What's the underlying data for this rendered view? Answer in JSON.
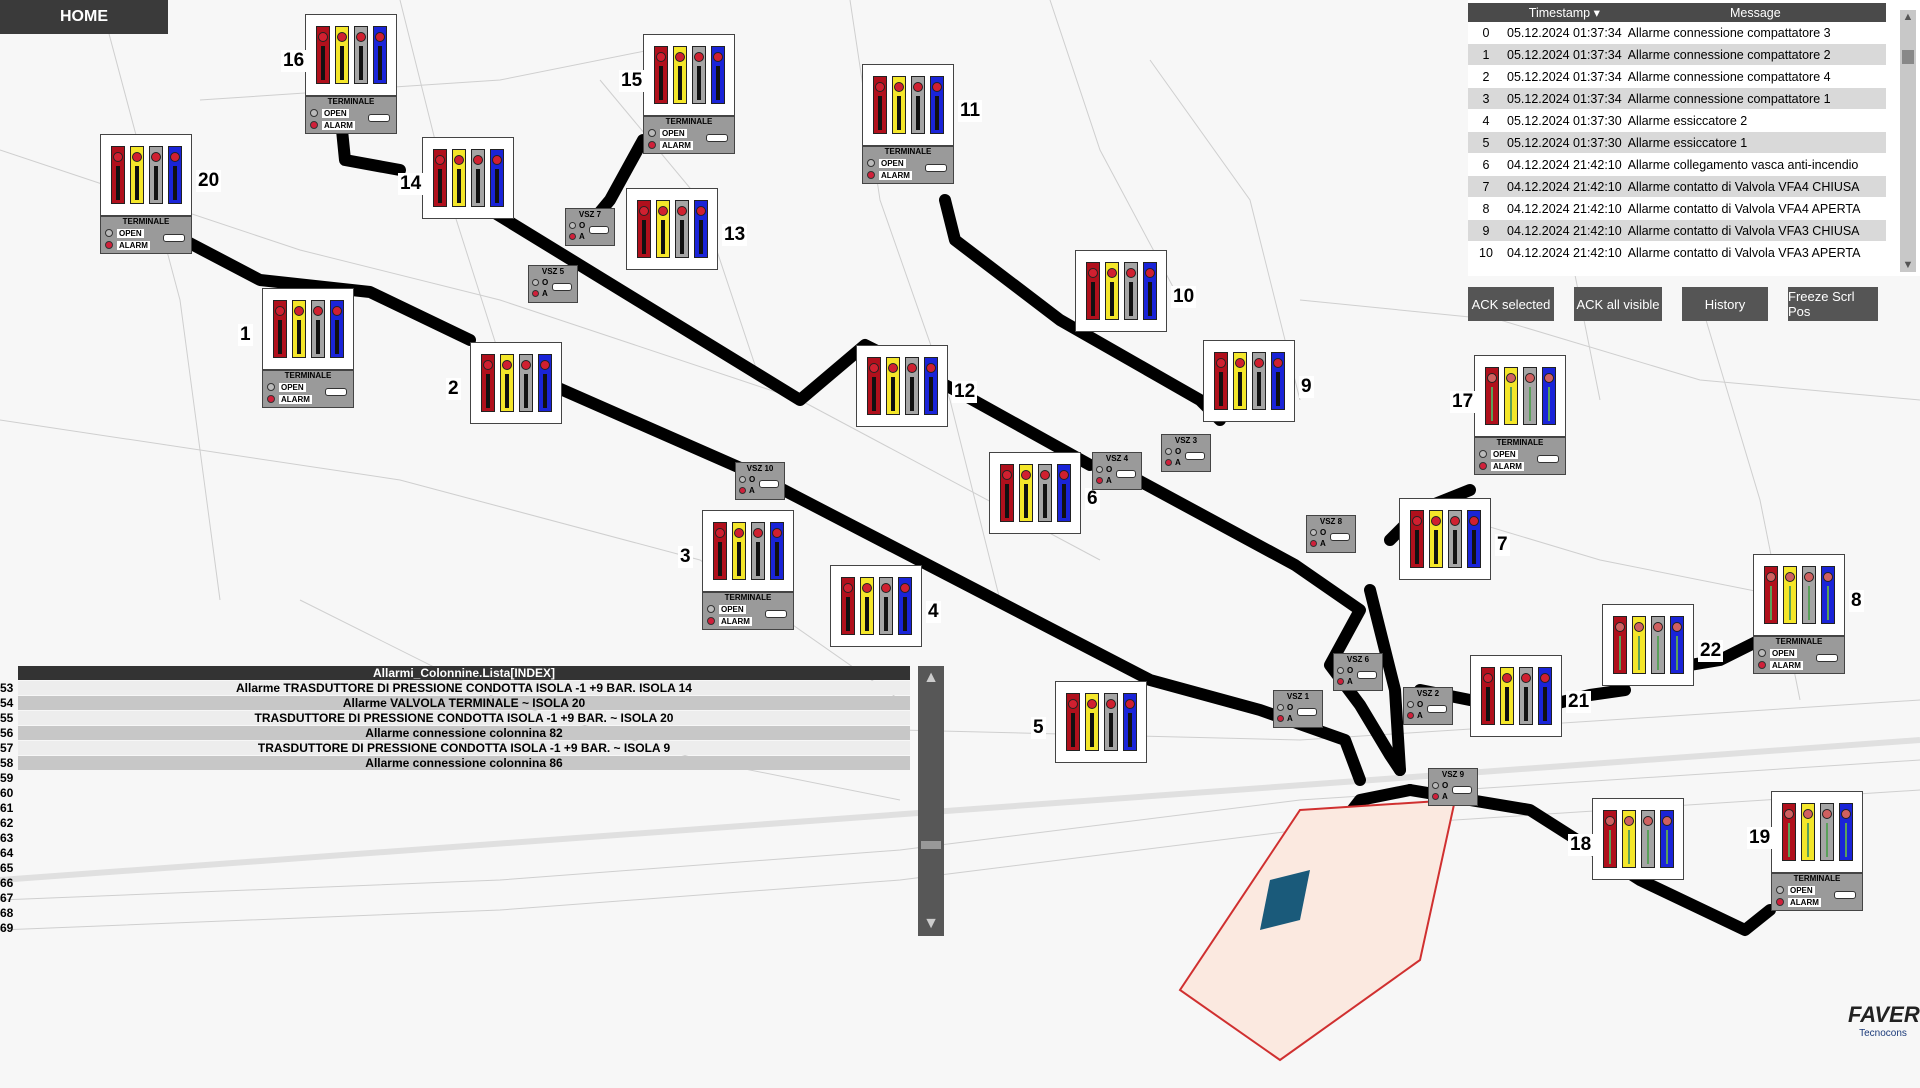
{
  "home_label": "HOME",
  "alarm_table": {
    "columns": [
      "",
      "Timestamp",
      "Message"
    ],
    "rows": [
      {
        "idx": "0",
        "ts": "05.12.2024 01:37:34",
        "msg": "Allarme connessione compattatore 3"
      },
      {
        "idx": "1",
        "ts": "05.12.2024 01:37:34",
        "msg": "Allarme connessione compattatore 2"
      },
      {
        "idx": "2",
        "ts": "05.12.2024 01:37:34",
        "msg": "Allarme connessione compattatore 4"
      },
      {
        "idx": "3",
        "ts": "05.12.2024 01:37:34",
        "msg": "Allarme connessione compattatore 1"
      },
      {
        "idx": "4",
        "ts": "05.12.2024 01:37:30",
        "msg": "Allarme essiccatore 2"
      },
      {
        "idx": "5",
        "ts": "05.12.2024 01:37:30",
        "msg": "Allarme essiccatore 1"
      },
      {
        "idx": "6",
        "ts": "04.12.2024 21:42:10",
        "msg": "Allarme collegamento vasca anti-incendio"
      },
      {
        "idx": "7",
        "ts": "04.12.2024 21:42:10",
        "msg": "Allarme contatto di Valvola VFA4 CHIUSA"
      },
      {
        "idx": "8",
        "ts": "04.12.2024 21:42:10",
        "msg": "Allarme contatto di Valvola VFA4 APERTA"
      },
      {
        "idx": "9",
        "ts": "04.12.2024 21:42:10",
        "msg": "Allarme contatto di Valvola VFA3 CHIUSA"
      },
      {
        "idx": "10",
        "ts": "04.12.2024 21:42:10",
        "msg": "Allarme contatto di Valvola VFA3 APERTA"
      }
    ]
  },
  "buttons": {
    "ack_selected": "ACK selected",
    "ack_all": "ACK all visible",
    "history": "History",
    "freeze": "Freeze Scrl Pos"
  },
  "list": {
    "header": "Allarmi_Colonnine.Lista[INDEX]",
    "rows": [
      {
        "n": "53",
        "t": "Allarme TRASDUTTORE DI PRESSIONE  CONDOTTA  ISOLA -1 +9 BAR. ISOLA 14"
      },
      {
        "n": "54",
        "t": "Allarme VALVOLA TERMINALE ~ ISOLA 20"
      },
      {
        "n": "55",
        "t": "TRASDUTTORE DI PRESSIONE  CONDOTTA  ISOLA -1 +9 BAR. ~ ISOLA 20"
      },
      {
        "n": "56",
        "t": "Allarme connessione colonnina 82"
      },
      {
        "n": "57",
        "t": "TRASDUTTORE DI PRESSIONE  CONDOTTA  ISOLA -1 +9 BAR. ~ ISOLA 9"
      },
      {
        "n": "58",
        "t": "Allarme connessione colonnina 86"
      },
      {
        "n": "59",
        "t": ""
      },
      {
        "n": "60",
        "t": ""
      },
      {
        "n": "61",
        "t": ""
      },
      {
        "n": "62",
        "t": ""
      },
      {
        "n": "63",
        "t": ""
      },
      {
        "n": "64",
        "t": ""
      },
      {
        "n": "65",
        "t": ""
      },
      {
        "n": "66",
        "t": ""
      },
      {
        "n": "67",
        "t": ""
      },
      {
        "n": "68",
        "t": ""
      },
      {
        "n": "69",
        "t": ""
      }
    ]
  },
  "terminal": {
    "title": "TERMINALE",
    "open": "OPEN",
    "alarm": "ALARM"
  },
  "islands": [
    "16",
    "15",
    "11",
    "14",
    "20",
    "13",
    "10",
    "1",
    "2",
    "9",
    "12",
    "17",
    "6",
    "3",
    "7",
    "4",
    "8",
    "22",
    "21",
    "5",
    "18",
    "19"
  ],
  "valves": [
    "VSZ 7",
    "VSZ 5",
    "VSZ 10",
    "VSZ 4",
    "VSZ 3",
    "VSZ 8",
    "VSZ 6",
    "VSZ 1",
    "VSZ 2",
    "VSZ 9"
  ],
  "valve_labels": {
    "o": "O",
    "a": "A"
  },
  "logos": {
    "brand": "FAVER",
    "brand2": "Tecnocons"
  },
  "colors": {
    "red": "#b0101c",
    "yellow": "#f4e62a",
    "grey": "#a5a5a5",
    "blue": "#1a24d8",
    "alarm": "#d0203a"
  }
}
